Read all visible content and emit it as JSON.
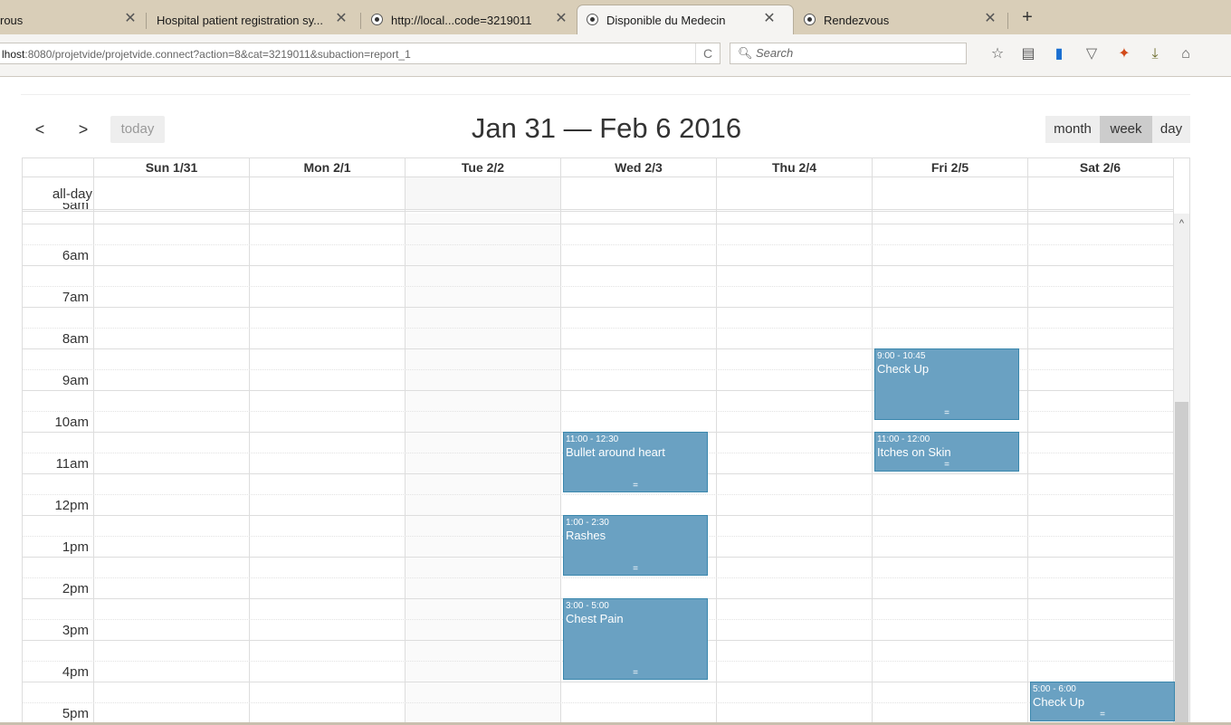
{
  "browser": {
    "tabs": [
      {
        "title": "rous",
        "active": false,
        "favicon": false
      },
      {
        "title": "Hospital patient registration sy...",
        "active": false,
        "favicon": false
      },
      {
        "title": "http://local...code=3219011",
        "active": false,
        "favicon": true
      },
      {
        "title": "Disponible du Medecin",
        "active": true,
        "favicon": true
      },
      {
        "title": "Rendezvous",
        "active": false,
        "favicon": true
      }
    ],
    "new_tab_icon": "+",
    "url_host": "lhost",
    "url_rest": ":8080/projetvide/projetvide.connect?action=8&cat=3219011&subaction=report_1",
    "reload_icon": "C",
    "search_placeholder": "Search",
    "toolbar_icons": [
      "star-icon",
      "reading-list-icon",
      "database-icon",
      "pocket-icon",
      "addon-icon",
      "download-icon",
      "home-icon"
    ]
  },
  "calendar": {
    "title": "Jan 31 — Feb 6 2016",
    "prev_label": "<",
    "next_label": ">",
    "today_label": "today",
    "views": {
      "month": "month",
      "week": "week",
      "day": "day"
    },
    "active_view": "week",
    "allday_label": "all-day",
    "days": [
      "Sun 1/31",
      "Mon 2/1",
      "Tue 2/2",
      "Wed 2/3",
      "Thu 2/4",
      "Fri 2/5",
      "Sat 2/6"
    ],
    "partial_top_label": "5am",
    "times": [
      "6am",
      "7am",
      "8am",
      "9am",
      "10am",
      "11am",
      "12pm",
      "1pm",
      "2pm",
      "3pm",
      "4pm",
      "5pm"
    ],
    "events": [
      {
        "day": 5,
        "time": "9:00 - 10:45",
        "title": "Check Up",
        "grip": "="
      },
      {
        "day": 3,
        "time": "11:00 - 12:30",
        "title": "Bullet around heart",
        "grip": "="
      },
      {
        "day": 5,
        "time": "11:00 - 12:00",
        "title": "Itches on Skin",
        "grip": "="
      },
      {
        "day": 3,
        "time": "1:00 - 2:30",
        "title": "Rashes",
        "grip": "="
      },
      {
        "day": 3,
        "time": "3:00 - 5:00",
        "title": "Chest Pain",
        "grip": "="
      },
      {
        "day": 6,
        "time": "5:00 - 6:00",
        "title": "Check Up",
        "grip": "="
      }
    ],
    "event_color": "#6aa1c2",
    "event_border": "#3a87ad"
  }
}
